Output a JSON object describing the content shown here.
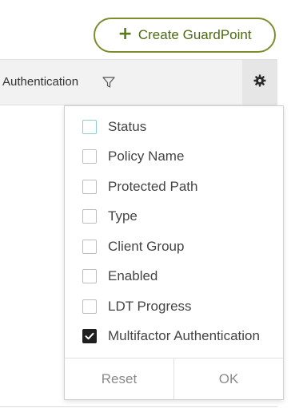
{
  "toolbar": {
    "create_button_label": "Create GuardPoint",
    "create_button_icon": "plus-icon"
  },
  "table": {
    "visible_column_title": "Authentication",
    "filter_icon": "filter-icon",
    "settings_icon": "gear-icon"
  },
  "column_menu": {
    "options": [
      {
        "label": "Status",
        "checked": false
      },
      {
        "label": "Policy Name",
        "checked": false
      },
      {
        "label": "Protected Path",
        "checked": false
      },
      {
        "label": "Type",
        "checked": false
      },
      {
        "label": "Client Group",
        "checked": false
      },
      {
        "label": "Enabled",
        "checked": false
      },
      {
        "label": "LDT Progress",
        "checked": false
      },
      {
        "label": "Multifactor Authentication",
        "checked": true
      }
    ],
    "reset_label": "Reset",
    "ok_label": "OK"
  },
  "colors": {
    "accent_green": "#7a8f2c",
    "checkbox_checked": "#1f1f1f",
    "focus_ring": "#8ccfd0"
  }
}
